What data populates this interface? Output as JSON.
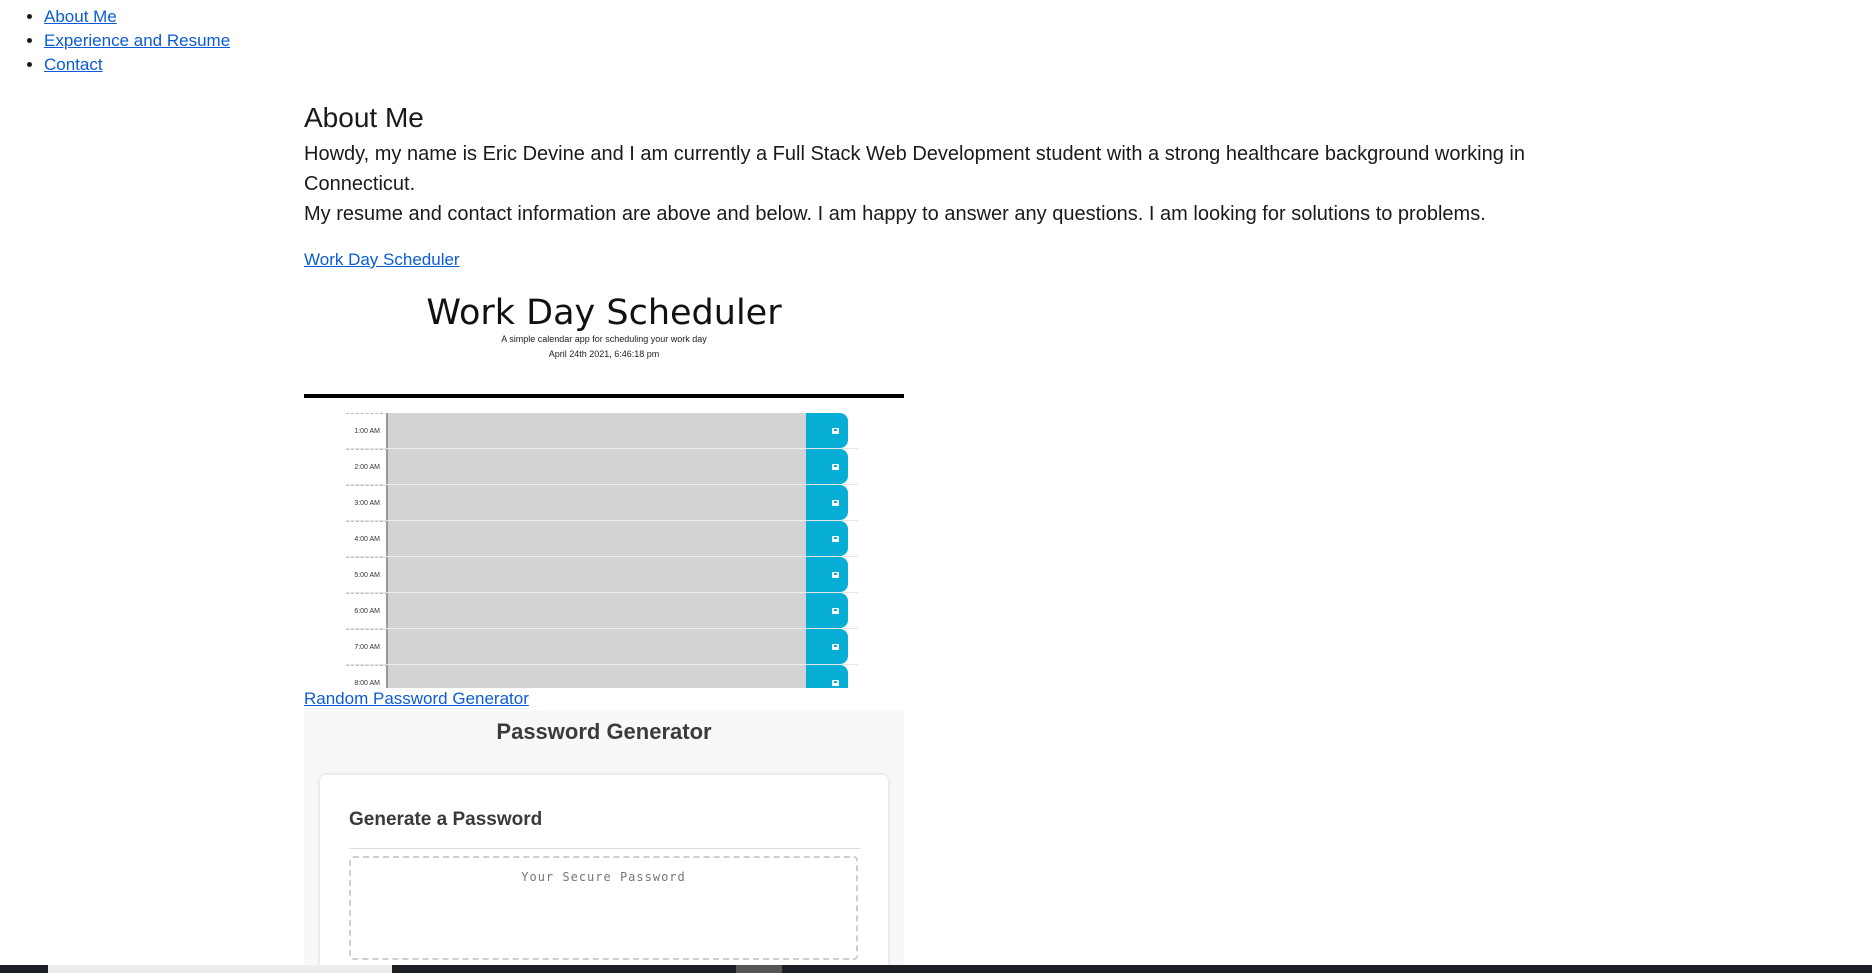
{
  "nav": {
    "items": [
      {
        "label": "About Me"
      },
      {
        "label": "Experience and Resume"
      },
      {
        "label": "Contact"
      }
    ]
  },
  "about": {
    "heading": "About Me",
    "paragraph1": "Howdy, my name is Eric Devine and I am currently a Full Stack Web Development student with a strong healthcare background working in Connecticut.",
    "paragraph2": "My resume and contact information are above and below. I am happy to answer any questions. I am looking for solutions to problems."
  },
  "projects": [
    {
      "link_label": "Work Day Scheduler",
      "preview": {
        "title": "Work Day Scheduler",
        "subtitle": "A simple calendar app for scheduling your work day",
        "date": "April 24th 2021, 6:46:18 pm",
        "hours": [
          "1:00 AM",
          "2:00 AM",
          "3:00 AM",
          "4:00 AM",
          "5:00 AM",
          "6:00 AM",
          "7:00 AM",
          "8:00 AM"
        ],
        "accent": "#06aed5"
      }
    },
    {
      "link_label": "Random Password Generator",
      "preview": {
        "title": "Password Generator",
        "card_heading": "Generate a Password",
        "placeholder": "Your Secure Password"
      }
    }
  ],
  "colors": {
    "link": "#0b5cd5",
    "textarea_gray": "#d3d3d3",
    "pg_background": "#f6f8fa"
  }
}
